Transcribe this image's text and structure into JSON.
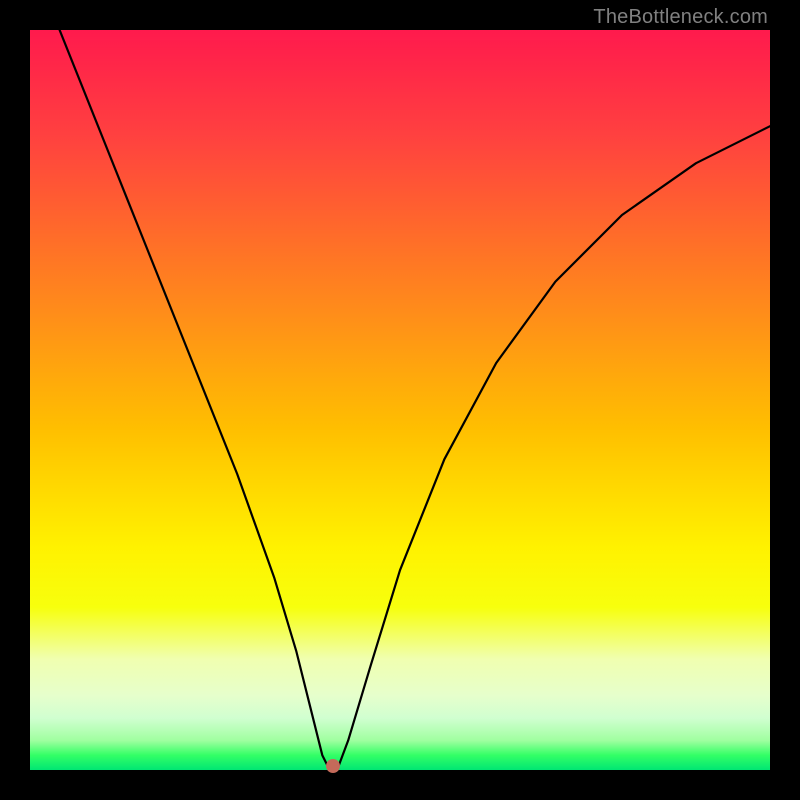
{
  "watermark": "TheBottleneck.com",
  "chart_data": {
    "type": "line",
    "title": "",
    "xlabel": "",
    "ylabel": "",
    "xlim": [
      0,
      100
    ],
    "ylim": [
      0,
      100
    ],
    "grid": false,
    "legend": false,
    "series": [
      {
        "name": "curve",
        "x": [
          4,
          10,
          16,
          22,
          28,
          33,
          36,
          38,
          39.5,
          40.5,
          41.5,
          43,
          46,
          50,
          56,
          63,
          71,
          80,
          90,
          100
        ],
        "y": [
          100,
          85,
          70,
          55,
          40,
          26,
          16,
          8,
          2,
          0,
          0,
          4,
          14,
          27,
          42,
          55,
          66,
          75,
          82,
          87
        ]
      }
    ],
    "marker": {
      "x": 41,
      "y": 0.5
    },
    "background_gradient": {
      "top": "#ff1a4d",
      "mid": "#ffd900",
      "bottom": "#00e673"
    }
  }
}
